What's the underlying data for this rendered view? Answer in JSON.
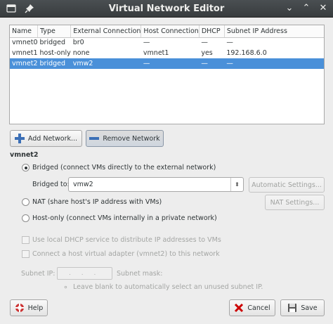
{
  "window": {
    "title": "Virtual Network Editor"
  },
  "table": {
    "columns": [
      "Name",
      "Type",
      "External Connection",
      "Host Connection",
      "DHCP",
      "Subnet IP Address"
    ],
    "rows": [
      {
        "name": "vmnet0",
        "type": "bridged",
        "external": "br0",
        "host": "—",
        "dhcp": "—",
        "subnet": "—"
      },
      {
        "name": "vmnet1",
        "type": "host-only",
        "external": "none",
        "host": "vmnet1",
        "dhcp": "yes",
        "subnet": "192.168.6.0"
      },
      {
        "name": "vmnet2",
        "type": "bridged",
        "external": "vmw2",
        "host": "—",
        "dhcp": "—",
        "subnet": "—"
      }
    ],
    "selected_row": 2
  },
  "buttons": {
    "add_network": "Add Network...",
    "remove_network": "Remove Network",
    "automatic_settings": "Automatic Settings...",
    "nat_settings": "NAT Settings...",
    "help": "Help",
    "cancel": "Cancel",
    "save": "Save"
  },
  "section": {
    "title": "vmnet2"
  },
  "options": {
    "bridged": "Bridged (connect VMs directly to the external network)",
    "bridged_to_label": "Bridged to:",
    "bridged_to_value": "vmw2",
    "nat": "NAT (share host's IP address with VMs)",
    "host_only": "Host-only (connect VMs internally in a private network)",
    "dhcp_check": "Use local DHCP service to distribute IP addresses to VMs",
    "adapter_check": "Connect a host virtual adapter (vmnet2) to this network",
    "subnet_ip_label": "Subnet IP:",
    "subnet_ip_placeholder": ". . .",
    "subnet_mask_label": "Subnet mask:",
    "hint": "Leave blank to automatically select an unused subnet IP."
  },
  "colors": {
    "selection": "#4a90d9",
    "titlebar": "#3c4043",
    "remove_icon": "#3b6fb6",
    "add_icon": "#3b6fb6",
    "cancel_icon": "#cc0000"
  }
}
